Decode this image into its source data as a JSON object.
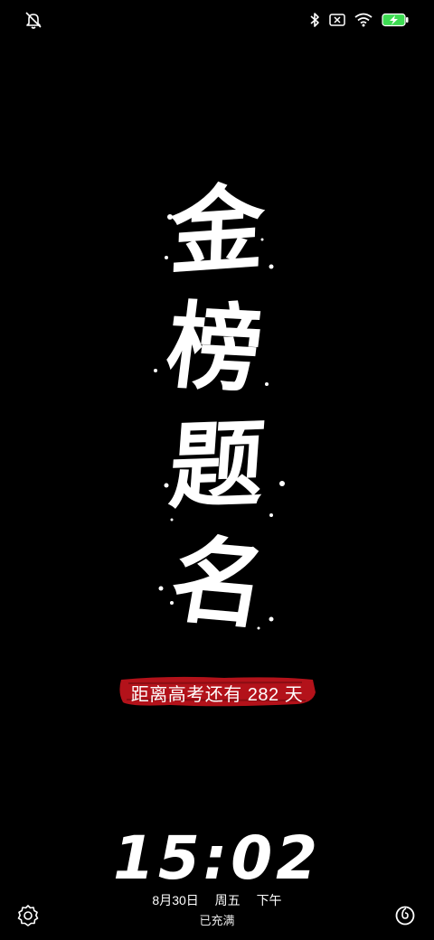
{
  "status_bar": {
    "left_icons": [
      "bell-off-icon"
    ],
    "right_icons": [
      "bluetooth-icon",
      "no-sim-icon",
      "wifi-icon",
      "battery-charging-icon"
    ],
    "battery_color": "#3ddc52"
  },
  "calligraphy": {
    "chars": [
      "金",
      "榜",
      "题",
      "名"
    ]
  },
  "countdown": {
    "text": "距离高考还有 282 天",
    "brush_color": "#b3121a"
  },
  "lock": {
    "time": "15:02",
    "date": "8月30日",
    "weekday": "周五",
    "period": "下午",
    "charge_status": "已充满"
  },
  "shortcuts": {
    "left": "settings-icon",
    "right": "music-app-icon"
  }
}
